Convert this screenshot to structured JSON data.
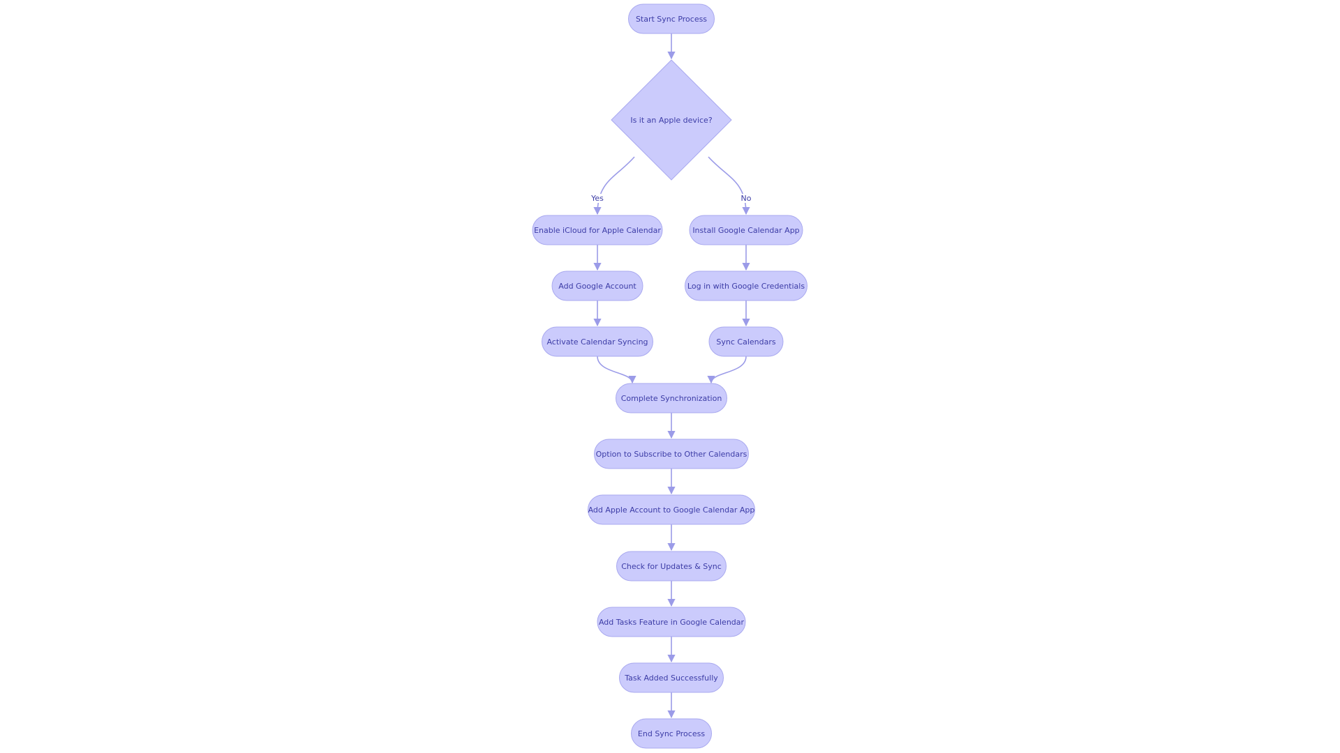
{
  "colors": {
    "node_fill": "#cbcbfc",
    "node_stroke": "#a9a9ef",
    "edge": "#9b9be8",
    "text": "#3c3ca6"
  },
  "nodes": [
    {
      "id": "start",
      "label": "Start Sync Process",
      "shape": "stadium"
    },
    {
      "id": "q",
      "label": "Is it an Apple device?",
      "shape": "diamond"
    },
    {
      "id": "icloud",
      "label": "Enable iCloud for Apple Calendar",
      "shape": "stadium"
    },
    {
      "id": "install",
      "label": "Install Google Calendar App",
      "shape": "stadium"
    },
    {
      "id": "addg",
      "label": "Add Google Account",
      "shape": "stadium"
    },
    {
      "id": "login",
      "label": "Log in with Google Credentials",
      "shape": "stadium"
    },
    {
      "id": "activate",
      "label": "Activate Calendar Syncing",
      "shape": "stadium"
    },
    {
      "id": "synccal",
      "label": "Sync Calendars",
      "shape": "stadium"
    },
    {
      "id": "complete",
      "label": "Complete Synchronization",
      "shape": "stadium"
    },
    {
      "id": "option",
      "label": "Option to Subscribe to Other Calendars",
      "shape": "stadium"
    },
    {
      "id": "addapple",
      "label": "Add Apple Account to Google Calendar App",
      "shape": "stadium"
    },
    {
      "id": "check",
      "label": "Check for Updates & Sync",
      "shape": "stadium"
    },
    {
      "id": "tasks",
      "label": "Add Tasks Feature in Google Calendar",
      "shape": "stadium"
    },
    {
      "id": "taskok",
      "label": "Task Added Successfully",
      "shape": "stadium"
    },
    {
      "id": "end",
      "label": "End Sync Process",
      "shape": "stadium"
    }
  ],
  "edges": [
    {
      "from": "start",
      "to": "q"
    },
    {
      "from": "q",
      "to": "icloud",
      "label": "Yes"
    },
    {
      "from": "q",
      "to": "install",
      "label": "No"
    },
    {
      "from": "icloud",
      "to": "addg"
    },
    {
      "from": "addg",
      "to": "activate"
    },
    {
      "from": "install",
      "to": "login"
    },
    {
      "from": "login",
      "to": "synccal"
    },
    {
      "from": "activate",
      "to": "complete"
    },
    {
      "from": "synccal",
      "to": "complete"
    },
    {
      "from": "complete",
      "to": "option"
    },
    {
      "from": "option",
      "to": "addapple"
    },
    {
      "from": "addapple",
      "to": "check"
    },
    {
      "from": "check",
      "to": "tasks"
    },
    {
      "from": "tasks",
      "to": "taskok"
    },
    {
      "from": "taskok",
      "to": "end"
    }
  ]
}
